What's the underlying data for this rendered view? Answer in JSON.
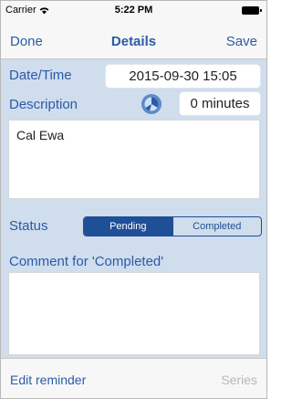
{
  "status_bar": {
    "carrier": "Carrier",
    "time": "5:22 PM"
  },
  "nav": {
    "done_label": "Done",
    "title": "Details",
    "save_label": "Save"
  },
  "form": {
    "datetime_label": "Date/Time",
    "datetime_value": "2015-09-30 15:05",
    "description_label": "Description",
    "duration_value": "0 minutes",
    "description_text": "Cal Ewa",
    "status_label": "Status",
    "status_options": [
      "Pending",
      "Completed"
    ],
    "status_selected": "Pending",
    "comment_label": "Comment for 'Completed'",
    "comment_text": ""
  },
  "toolbar": {
    "edit_reminder_label": "Edit reminder",
    "series_label": "Series"
  },
  "colors": {
    "accent": "#2b5ba8",
    "segment_active": "#1f4f96",
    "background": "#cfdded"
  },
  "icons": [
    "wifi-icon",
    "battery-icon",
    "timer-icon"
  ]
}
